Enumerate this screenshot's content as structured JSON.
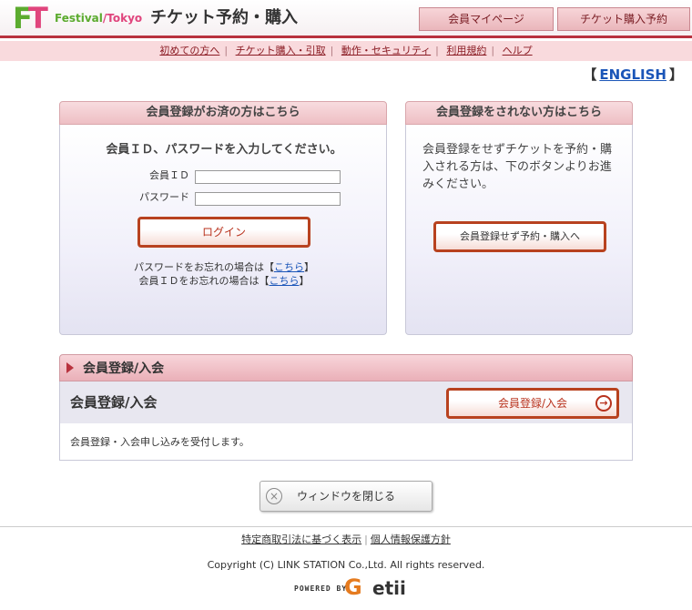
{
  "header": {
    "logo_f": "F",
    "logo_t": "T",
    "brand_part1": "Festival",
    "brand_part2": "Tokyo",
    "title": "チケット予約・購入",
    "mypage_button": "会員マイページ",
    "ticket_button": "チケット購入予約"
  },
  "subnav": {
    "items": [
      "初めての方へ",
      "チケット購入・引取",
      "動作・セキュリティ",
      "利用規約",
      "ヘルプ"
    ]
  },
  "language": {
    "bracket_open": "【",
    "link": "ENGLISH",
    "bracket_close": "】"
  },
  "login_panel": {
    "title": "会員登録がお済の方はこちら",
    "instruction": "会員ＩＤ、パスワードを入力してください。",
    "id_label": "会員ＩＤ",
    "password_label": "パスワード",
    "login_button": "ログイン",
    "forgot_password_prefix": "パスワードをお忘れの場合は【",
    "forgot_password_link": "こちら",
    "forgot_password_suffix": "】",
    "forgot_id_prefix": "会員ＩＤをお忘れの場合は【",
    "forgot_id_link": "こちら",
    "forgot_id_suffix": "】"
  },
  "guest_panel": {
    "title": "会員登録をされない方はこちら",
    "text": "会員登録をせずチケットを予約・購入される方は、下のボタンよりお進みください。",
    "button": "会員登録せず予約・購入へ"
  },
  "registration": {
    "section_title": "会員登録/入会",
    "sub_title": "会員登録/入会",
    "button": "会員登録/入会",
    "description": "会員登録・入会申し込みを受付します。"
  },
  "close_button": "ウィンドウを閉じる",
  "footer": {
    "link1": "特定商取引法に基づく表示",
    "link2": "個人情報保護方針",
    "copyright": "Copyright (C) LINK STATION Co.,Ltd. All rights reserved.",
    "powered_by": "POWERED BY",
    "getii_g": "G",
    "getii_rest": "etii"
  },
  "colors": {
    "accent_red": "#b8323e",
    "button_border": "#b8421f",
    "logo_green": "#5cab2f",
    "logo_pink": "#e0457d",
    "link_blue": "#1a55b8"
  }
}
